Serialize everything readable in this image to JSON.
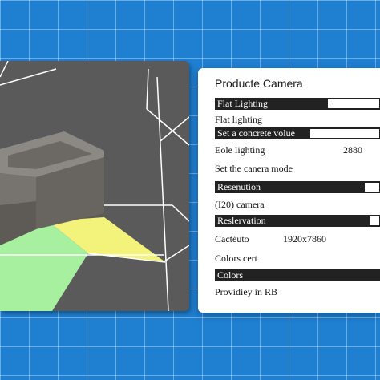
{
  "panel": {
    "title": "Producte Camera",
    "flat_lighting_bar": "Flat Lighting",
    "flat_lighting_text": "Flat lighting",
    "concrete_bar": "Set a concrete volue",
    "eole_label": "Eole lighting",
    "eole_value": "2880",
    "camera_mode_text": "Set the canera mode",
    "resenution_bar": "Resenution",
    "camera_text": "(I20) camera",
    "reslervation_bar": "Reslervation",
    "cactuto_label": "Cactéuto",
    "cactuto_value": "1920x7860",
    "colors_cert_text": "Colors cert",
    "colors_bar": "Colors",
    "provider_text": "Providiey in RB"
  },
  "viewport": {
    "floor_color": "#5a5a5a",
    "yellow_plane": "#f3f27a",
    "green_plane": "#a6f0a0",
    "box_color": "#76726d"
  },
  "colors": {
    "background": "#1f7fd1",
    "bar_dark": "#222222",
    "panel_bg": "#ffffff"
  }
}
